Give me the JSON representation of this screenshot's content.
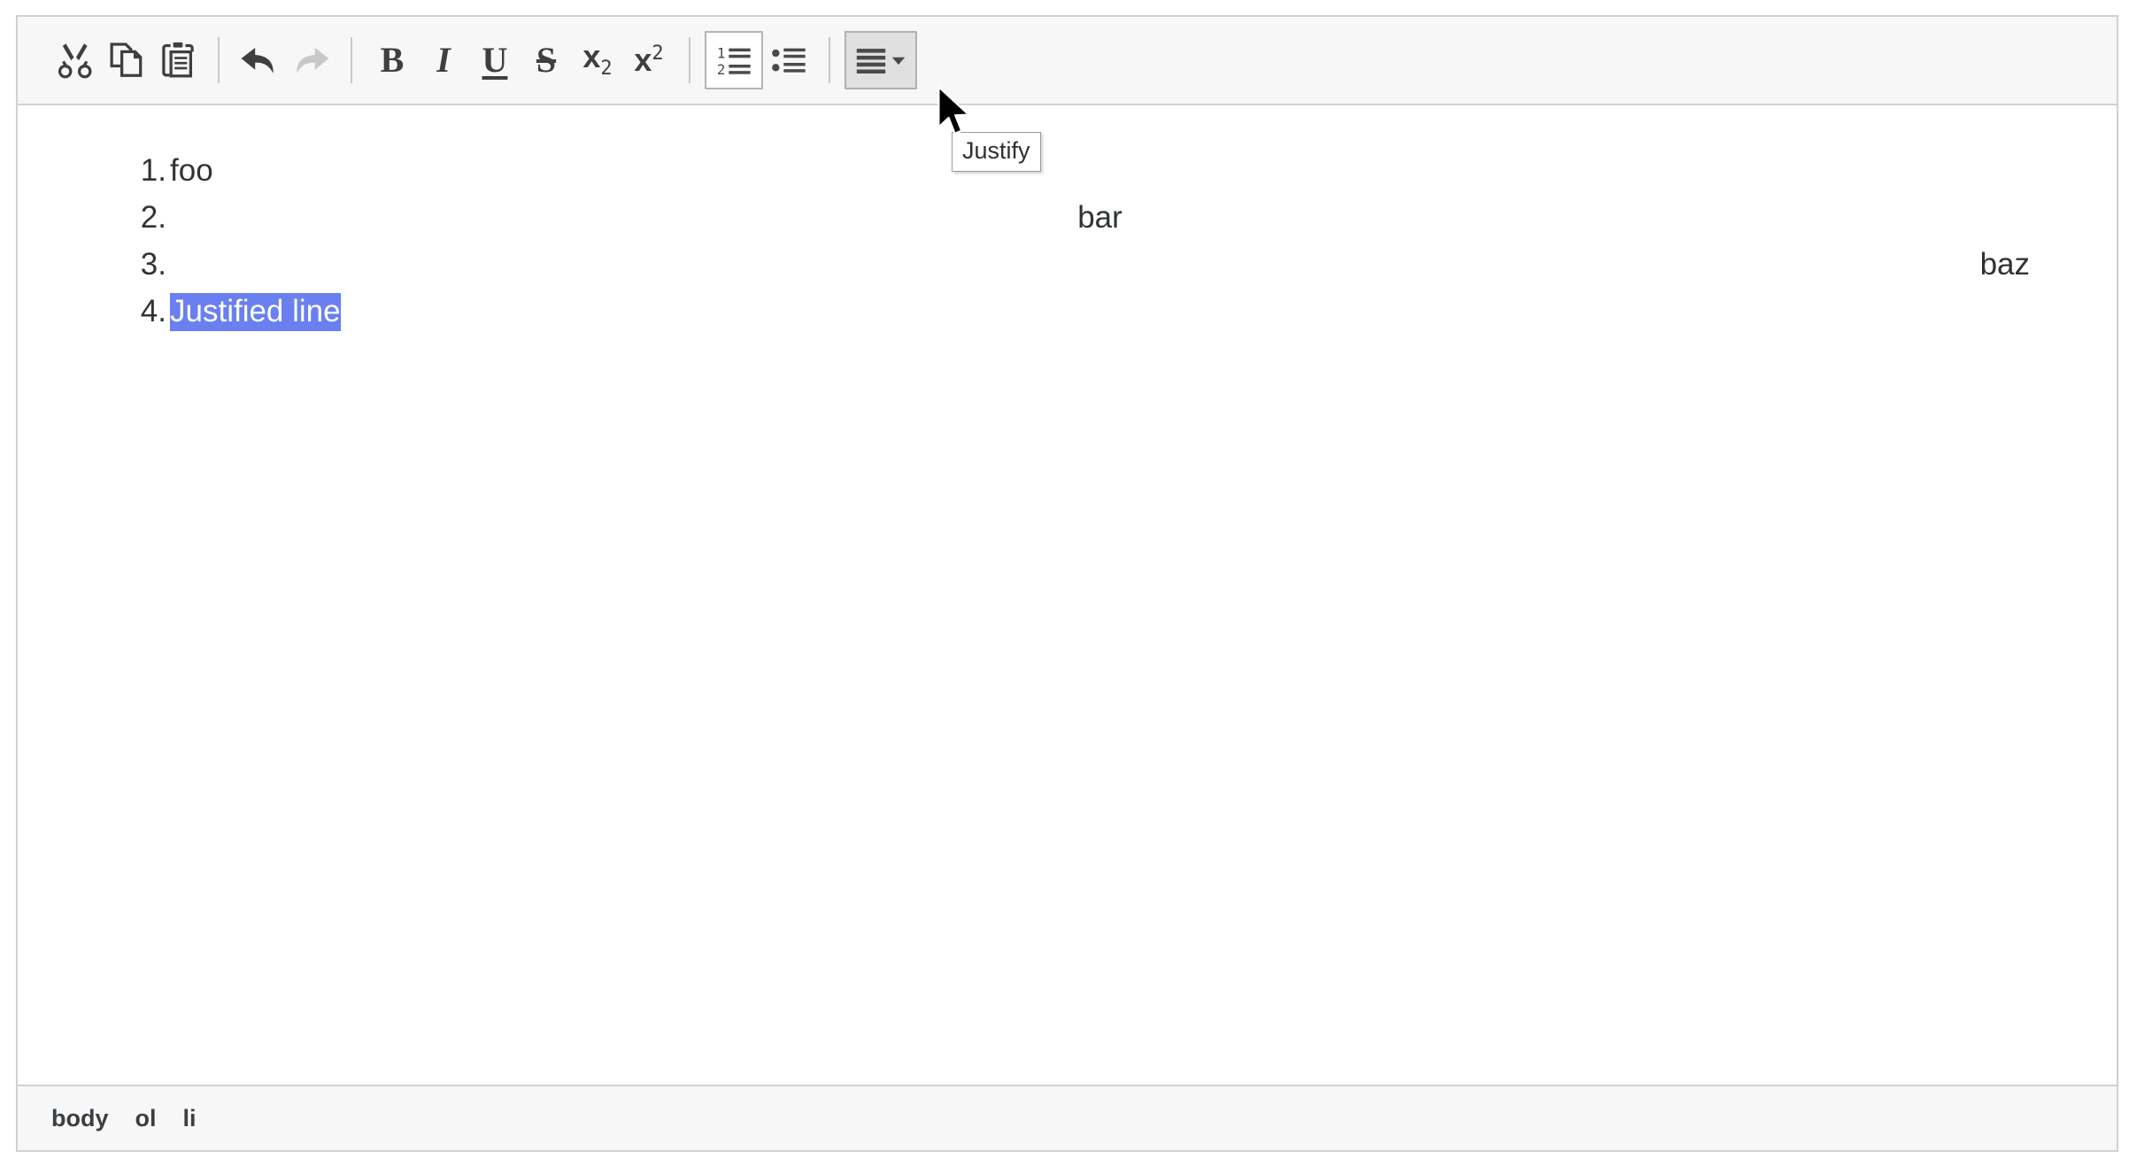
{
  "editor": {
    "name": "rich-text-editor"
  },
  "toolbar": {
    "groups": [
      {
        "name": "clipboard",
        "buttons": [
          {
            "label": "Cut",
            "icon": "scissors-icon",
            "state": "enabled"
          },
          {
            "label": "Copy",
            "icon": "copy-icon",
            "state": "enabled"
          },
          {
            "label": "Paste",
            "icon": "paste-icon",
            "state": "enabled"
          }
        ]
      },
      {
        "name": "history",
        "buttons": [
          {
            "label": "Undo",
            "icon": "undo-arrow-icon",
            "state": "enabled"
          },
          {
            "label": "Redo",
            "icon": "redo-arrow-icon",
            "state": "disabled"
          }
        ]
      },
      {
        "name": "basic-styles",
        "buttons": [
          {
            "label": "Bold",
            "icon": "bold-icon",
            "glyph": "B",
            "state": "enabled"
          },
          {
            "label": "Italic",
            "icon": "italic-icon",
            "glyph": "I",
            "state": "enabled"
          },
          {
            "label": "Underline",
            "icon": "underline-icon",
            "glyph": "U",
            "state": "enabled"
          },
          {
            "label": "Strikethrough",
            "icon": "strikethrough-icon",
            "glyph": "S",
            "state": "enabled"
          },
          {
            "label": "Subscript",
            "icon": "subscript-icon",
            "glyph": "x",
            "sub": "2",
            "state": "enabled"
          },
          {
            "label": "Superscript",
            "icon": "superscript-icon",
            "glyph": "x",
            "sup": "2",
            "state": "enabled"
          }
        ]
      },
      {
        "name": "lists",
        "buttons": [
          {
            "label": "Insert/Remove Numbered List",
            "icon": "numbered-list-icon",
            "state": "active"
          },
          {
            "label": "Insert/Remove Bulleted List",
            "icon": "bulleted-list-icon",
            "state": "enabled"
          }
        ]
      },
      {
        "name": "alignment",
        "buttons": [
          {
            "label": "Justify",
            "icon": "justify-icon",
            "state": "hovered",
            "has_dropdown": true,
            "dropdown_icon": "chevron-down-icon"
          }
        ]
      }
    ]
  },
  "tooltip": {
    "visible": true,
    "text": "Justify"
  },
  "content": {
    "list_type": "ordered",
    "items": [
      {
        "number": "1.",
        "text": "foo",
        "align": "left",
        "selected": false
      },
      {
        "number": "2.",
        "text": "bar",
        "align": "center",
        "selected": false
      },
      {
        "number": "3.",
        "text": "baz",
        "align": "right",
        "selected": false
      },
      {
        "number": "4.",
        "text": "Justified line",
        "align": "left",
        "selected": true
      }
    ]
  },
  "statusbar": {
    "element_path": [
      "body",
      "ol",
      "li"
    ]
  },
  "colors": {
    "toolbar_bg": "#f7f7f7",
    "border": "#d1d1d1",
    "icon_dark": "#3f3f3f",
    "icon_disabled": "#c8c8c8",
    "selection_bg": "#6a7ff0",
    "selection_fg": "#ffffff",
    "text": "#2f3336",
    "button_hover_bg": "#e0e0e0",
    "button_active_bg": "#ffffff"
  }
}
